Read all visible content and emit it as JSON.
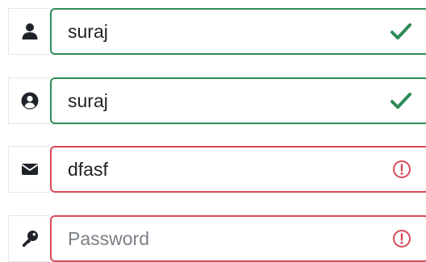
{
  "form": {
    "fields": [
      {
        "name": "username",
        "icon": "user-icon",
        "type": "text",
        "value": "suraj",
        "placeholder": "",
        "status": "valid"
      },
      {
        "name": "display-name",
        "icon": "user-circle-icon",
        "type": "text",
        "value": "suraj",
        "placeholder": "",
        "status": "valid"
      },
      {
        "name": "email",
        "icon": "envelope-icon",
        "type": "text",
        "value": "dfasf",
        "placeholder": "",
        "status": "invalid"
      },
      {
        "name": "password",
        "icon": "key-icon",
        "type": "password",
        "value": "",
        "placeholder": "Password",
        "status": "invalid"
      }
    ]
  },
  "colors": {
    "valid": "#2f8a57",
    "invalid": "#d64a59",
    "icon": "#1f2329"
  }
}
